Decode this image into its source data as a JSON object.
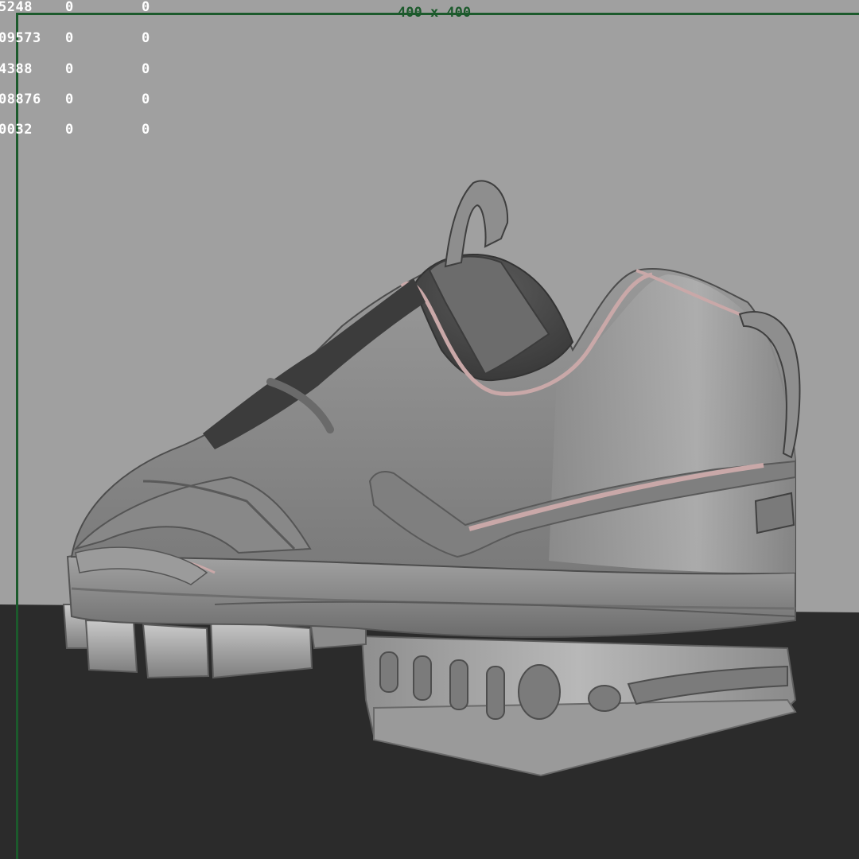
{
  "viewport": {
    "resolution_label": "400 x 400",
    "background_color": "#a0a0a0",
    "floor_color": "#2b2b2b",
    "resolution_gate_color": "#1c5a2c"
  },
  "hud": {
    "rows": [
      {
        "c0": "5248",
        "c1": "0",
        "c2": "0"
      },
      {
        "c0": "09573",
        "c1": "0",
        "c2": "0"
      },
      {
        "c0": "4388",
        "c1": "0",
        "c2": "0"
      },
      {
        "c0": "08876",
        "c1": "0",
        "c2": "0"
      },
      {
        "c0": "0032",
        "c1": "0",
        "c2": "0"
      }
    ]
  },
  "model": {
    "type": "shoe",
    "material_color": "#8a8a8a",
    "accent_color": "#c9a8a8"
  }
}
